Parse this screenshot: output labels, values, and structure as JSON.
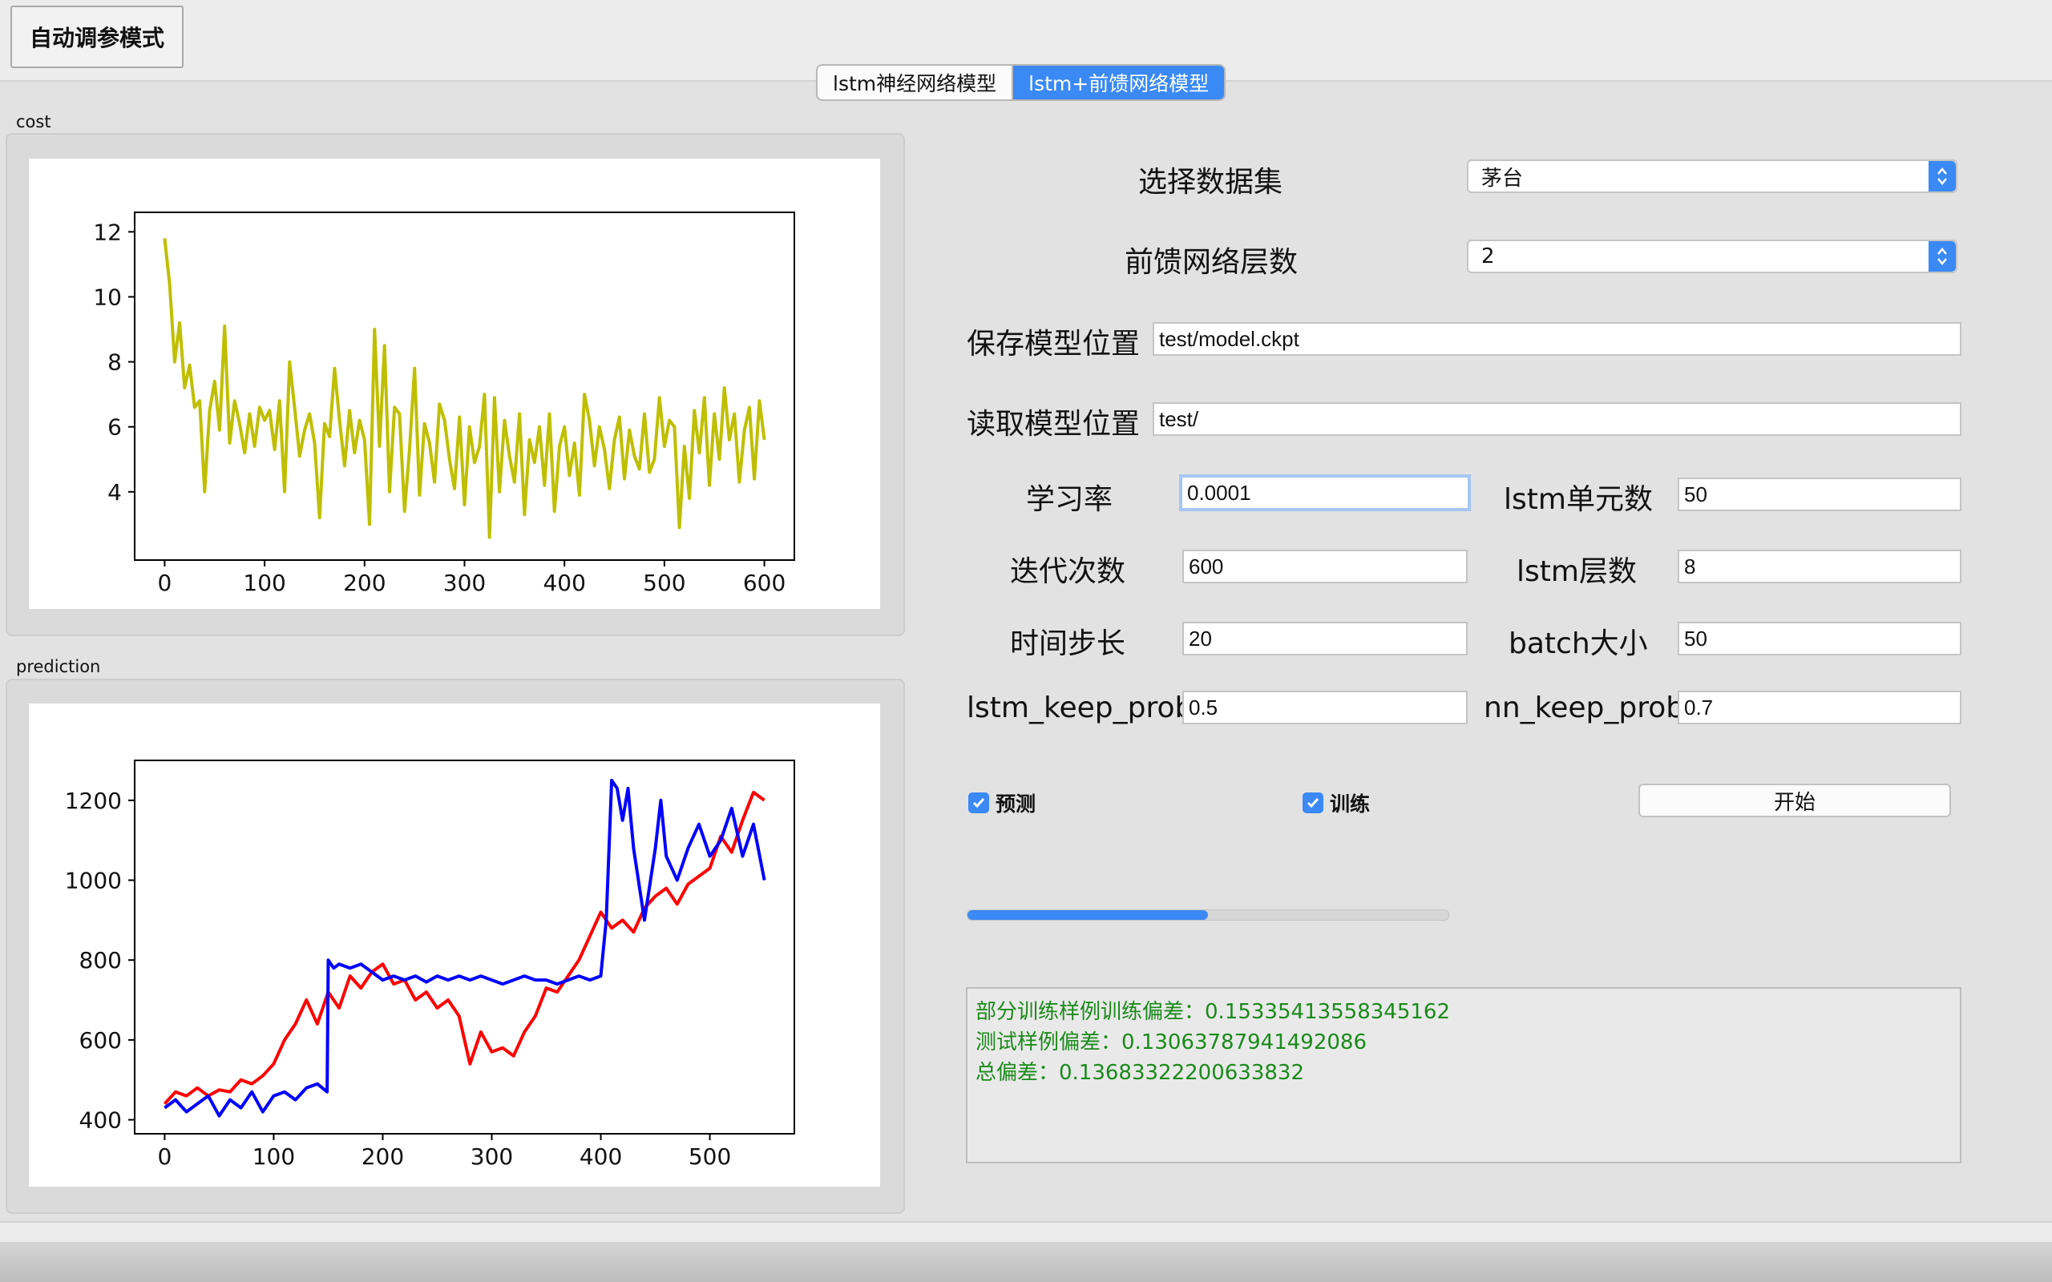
{
  "mode_button": "自动调参模式",
  "tabs": [
    {
      "label": "lstm神经网络模型",
      "selected": false
    },
    {
      "label": "lstm+前馈网络模型",
      "selected": true
    }
  ],
  "cost_group": {
    "label": "cost"
  },
  "prediction_group": {
    "label": "prediction"
  },
  "form": {
    "dataset_label": "选择数据集",
    "dataset_value": "茅台",
    "ffn_layers_label": "前馈网络层数",
    "ffn_layers_value": "2",
    "save_path_label": "保存模型位置",
    "save_path_value": "test/model.ckpt",
    "load_path_label": "读取模型位置",
    "load_path_value": "test/",
    "learning_rate_label": "学习率",
    "learning_rate_value": "0.0001",
    "lstm_units_label": "lstm单元数",
    "lstm_units_value": "50",
    "iterations_label": "迭代次数",
    "iterations_value": "600",
    "lstm_layers_label": "lstm层数",
    "lstm_layers_value": "8",
    "time_step_label": "时间步长",
    "time_step_value": "20",
    "batch_size_label": "batch大小",
    "batch_size_value": "50",
    "lstm_keep_prob_label": "lstm_keep_prob",
    "lstm_keep_prob_value": "0.5",
    "nn_keep_prob_label": "nn_keep_prob",
    "nn_keep_prob_value": "0.7"
  },
  "checkboxes": {
    "predict_label": "预测",
    "predict_checked": true,
    "train_label": "训练",
    "train_checked": true
  },
  "start_button": "开始",
  "progress": 0.5,
  "log": [
    "部分训练样例训练偏差：0.15335413558345162",
    "测试样例偏差：0.13063787941492086",
    "总偏差：0.13683322200633832"
  ],
  "colors": {
    "accent": "#3a89f5",
    "cost_line": "#bfbf00",
    "pred_red": "#ff0000",
    "pred_blue": "#0000ff",
    "log_text": "#1a8a1a"
  },
  "chart_data": [
    {
      "type": "line",
      "title": "",
      "xlabel": "",
      "ylabel": "",
      "xlim": [
        -30,
        630
      ],
      "ylim": [
        1.9,
        12.6
      ],
      "xticks": [
        0,
        100,
        200,
        300,
        400,
        500,
        600
      ],
      "yticks": [
        4,
        6,
        8,
        10,
        12
      ],
      "grid": false,
      "series": [
        {
          "color": "#bfbf00",
          "x": [
            0,
            5,
            10,
            15,
            20,
            25,
            30,
            35,
            40,
            45,
            50,
            55,
            60,
            65,
            70,
            75,
            80,
            85,
            90,
            95,
            100,
            105,
            110,
            115,
            120,
            125,
            130,
            135,
            140,
            145,
            150,
            155,
            160,
            165,
            170,
            175,
            180,
            185,
            190,
            195,
            200,
            205,
            210,
            215,
            220,
            225,
            230,
            235,
            240,
            245,
            250,
            255,
            260,
            265,
            270,
            275,
            280,
            285,
            290,
            295,
            300,
            305,
            310,
            315,
            320,
            325,
            330,
            335,
            340,
            345,
            350,
            355,
            360,
            365,
            370,
            375,
            380,
            385,
            390,
            395,
            400,
            405,
            410,
            415,
            420,
            425,
            430,
            435,
            440,
            445,
            450,
            455,
            460,
            465,
            470,
            475,
            480,
            485,
            490,
            495,
            500,
            505,
            510,
            515,
            520,
            525,
            530,
            535,
            540,
            545,
            550,
            555,
            560,
            565,
            570,
            575,
            580,
            585,
            590,
            595,
            600
          ],
          "values": [
            11.8,
            10.4,
            8.0,
            9.2,
            7.2,
            7.9,
            6.6,
            6.8,
            4.0,
            6.5,
            7.4,
            5.9,
            9.1,
            5.5,
            6.8,
            6.1,
            5.2,
            6.4,
            5.4,
            6.6,
            6.2,
            6.5,
            5.3,
            6.8,
            4.0,
            8.0,
            6.6,
            5.1,
            5.9,
            6.4,
            5.5,
            3.2,
            6.1,
            5.7,
            7.8,
            6.2,
            4.8,
            6.5,
            5.2,
            6.2,
            5.6,
            3.0,
            9.0,
            5.4,
            8.5,
            4.0,
            6.6,
            6.4,
            3.4,
            5.3,
            7.8,
            3.9,
            6.1,
            5.5,
            4.3,
            6.7,
            6.2,
            5.0,
            4.1,
            6.3,
            3.6,
            6.0,
            4.9,
            5.4,
            7.0,
            2.6,
            6.9,
            4.0,
            6.2,
            5.1,
            4.3,
            6.4,
            3.3,
            5.6,
            4.9,
            6.0,
            4.2,
            6.4,
            3.4,
            5.4,
            6.0,
            4.5,
            5.5,
            3.9,
            7.0,
            6.2,
            4.8,
            6.0,
            5.3,
            4.1,
            5.6,
            6.3,
            4.4,
            5.9,
            5.1,
            4.7,
            6.4,
            4.6,
            5.0,
            6.9,
            5.4,
            6.2,
            6.0,
            2.9,
            5.4,
            3.8,
            6.5,
            5.2,
            6.9,
            4.2,
            6.4,
            5.0,
            7.2,
            5.6,
            6.4,
            4.3,
            5.9,
            6.6,
            4.4,
            6.8,
            5.6
          ]
        }
      ]
    },
    {
      "type": "line",
      "title": "",
      "xlabel": "",
      "ylabel": "",
      "xlim": [
        -27.5,
        577.5
      ],
      "ylim": [
        365,
        1300
      ],
      "xticks": [
        0,
        100,
        200,
        300,
        400,
        500
      ],
      "yticks": [
        400,
        600,
        800,
        1000,
        1200
      ],
      "grid": false,
      "series": [
        {
          "color": "#ff0000",
          "x": [
            0,
            10,
            20,
            30,
            40,
            50,
            60,
            70,
            80,
            90,
            100,
            110,
            120,
            130,
            140,
            150,
            160,
            170,
            180,
            190,
            200,
            210,
            220,
            230,
            240,
            250,
            260,
            270,
            280,
            290,
            300,
            310,
            320,
            330,
            340,
            350,
            360,
            370,
            380,
            390,
            400,
            410,
            420,
            430,
            440,
            450,
            460,
            470,
            480,
            490,
            500,
            510,
            520,
            530,
            540,
            550
          ],
          "values": [
            440,
            470,
            460,
            480,
            460,
            475,
            470,
            500,
            490,
            510,
            540,
            600,
            640,
            700,
            640,
            720,
            680,
            760,
            730,
            770,
            790,
            740,
            750,
            700,
            720,
            680,
            700,
            660,
            540,
            620,
            570,
            580,
            560,
            620,
            660,
            730,
            720,
            760,
            800,
            860,
            920,
            880,
            900,
            870,
            930,
            960,
            980,
            940,
            990,
            1010,
            1030,
            1110,
            1070,
            1150,
            1220,
            1200
          ]
        },
        {
          "color": "#0000ff",
          "x": [
            0,
            10,
            20,
            30,
            40,
            50,
            60,
            70,
            80,
            90,
            100,
            110,
            120,
            130,
            140,
            149,
            150,
            155,
            160,
            170,
            180,
            190,
            200,
            210,
            220,
            230,
            240,
            250,
            260,
            270,
            280,
            290,
            300,
            310,
            320,
            330,
            340,
            350,
            360,
            370,
            380,
            390,
            400,
            405,
            410,
            415,
            420,
            425,
            430,
            440,
            450,
            455,
            460,
            470,
            480,
            490,
            500,
            510,
            520,
            530,
            540,
            550
          ],
          "values": [
            430,
            450,
            420,
            440,
            460,
            410,
            450,
            430,
            470,
            420,
            460,
            470,
            450,
            480,
            490,
            470,
            800,
            780,
            790,
            780,
            790,
            770,
            750,
            760,
            750,
            760,
            745,
            760,
            750,
            760,
            750,
            760,
            750,
            740,
            750,
            760,
            750,
            750,
            740,
            750,
            760,
            750,
            760,
            900,
            1250,
            1230,
            1150,
            1230,
            1080,
            900,
            1080,
            1200,
            1060,
            1000,
            1080,
            1140,
            1060,
            1100,
            1180,
            1060,
            1140,
            1000
          ]
        }
      ]
    }
  ]
}
